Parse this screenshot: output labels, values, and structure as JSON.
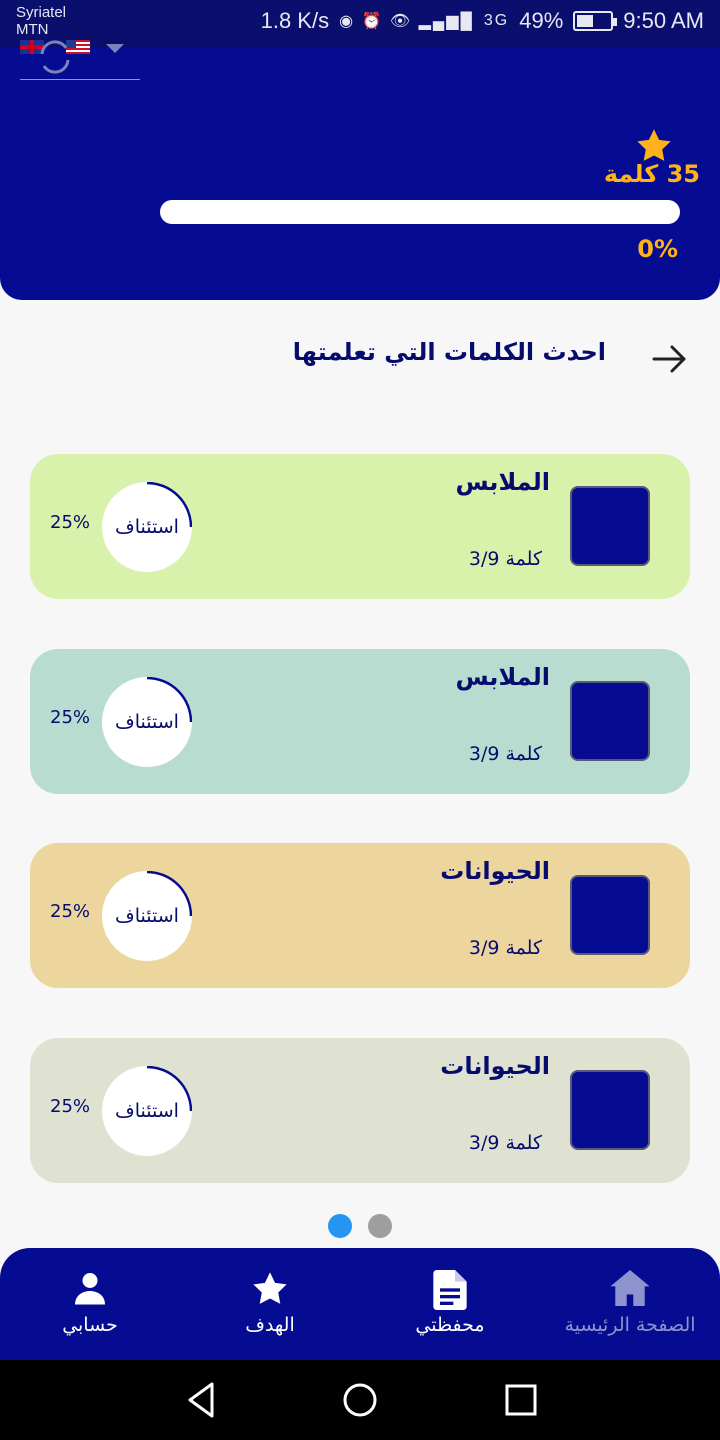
{
  "status_bar": {
    "carrier_1": "Syriatel",
    "carrier_2": "MTN",
    "speed": "1.8 K/s",
    "network": "3G",
    "battery": "49%",
    "battery_level": 0.49,
    "time": "9:50 AM"
  },
  "header": {
    "word_count": "35 كلمة",
    "progress_text": "0%",
    "progress_value": 0
  },
  "section": {
    "title": "احدث الكلمات التي تعلمتها"
  },
  "cards": [
    {
      "title": "الملابس",
      "subtitle": "كلمة 3/9",
      "resume_label": "استئناف",
      "percent": "25%",
      "progress": 0.25,
      "bg_color": "#d9f2ab"
    },
    {
      "title": "الملابس",
      "subtitle": "كلمة 3/9",
      "resume_label": "استئناف",
      "percent": "25%",
      "progress": 0.25,
      "bg_color": "#b8dccf"
    },
    {
      "title": "الحيوانات",
      "subtitle": "كلمة 3/9",
      "resume_label": "استئناف",
      "percent": "25%",
      "progress": 0.25,
      "bg_color": "#edd59e"
    },
    {
      "title": "الحيوانات",
      "subtitle": "كلمة 3/9",
      "resume_label": "استئناف",
      "percent": "25%",
      "progress": 0.25,
      "bg_color": "#dfe2d0"
    }
  ],
  "pager": {
    "active_page": 1,
    "page_count": 2
  },
  "bottom_nav": {
    "account": "حسابي",
    "goal": "الهدف",
    "wallet": "محفظتي",
    "home": "الصفحة الرئيسية"
  },
  "colors": {
    "primary": "#060c92",
    "accent": "#ffb21a",
    "dot_active": "#2496f2",
    "dot_inactive": "#9e9e9e"
  },
  "icons": {
    "star": "star-icon",
    "arrow": "arrow-right-icon",
    "account": "user-icon",
    "goal": "star-icon",
    "wallet": "document-icon",
    "home": "home-icon"
  }
}
